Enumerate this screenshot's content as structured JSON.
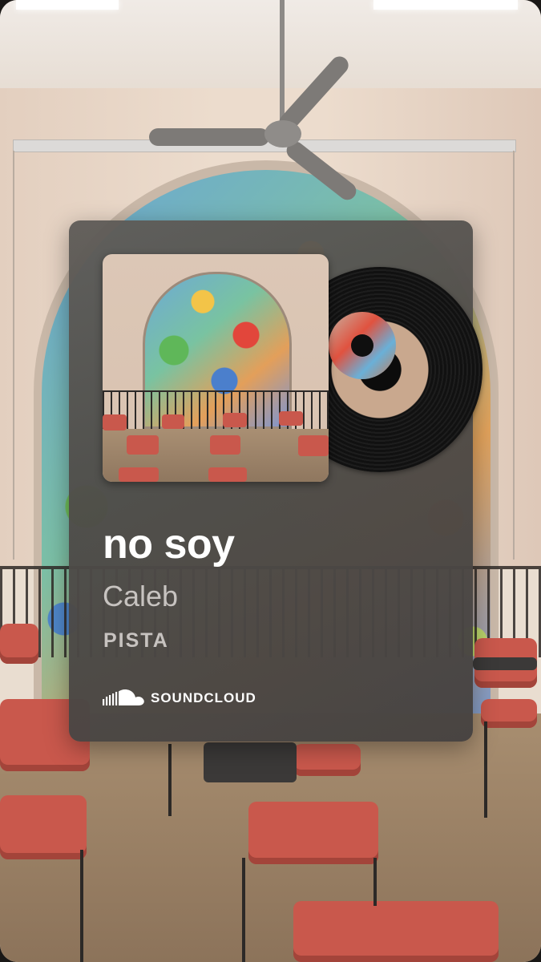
{
  "track": {
    "title": "no soy",
    "artist": "Caleb",
    "type_label": "PISTA"
  },
  "source": {
    "brand": "SOUNDCLOUD",
    "icon": "soundcloud-icon"
  },
  "colors": {
    "card_background": "#5a5754",
    "title_text": "#ffffff",
    "secondary_text": "#c7c3c0",
    "brand_text": "#ffffff"
  }
}
